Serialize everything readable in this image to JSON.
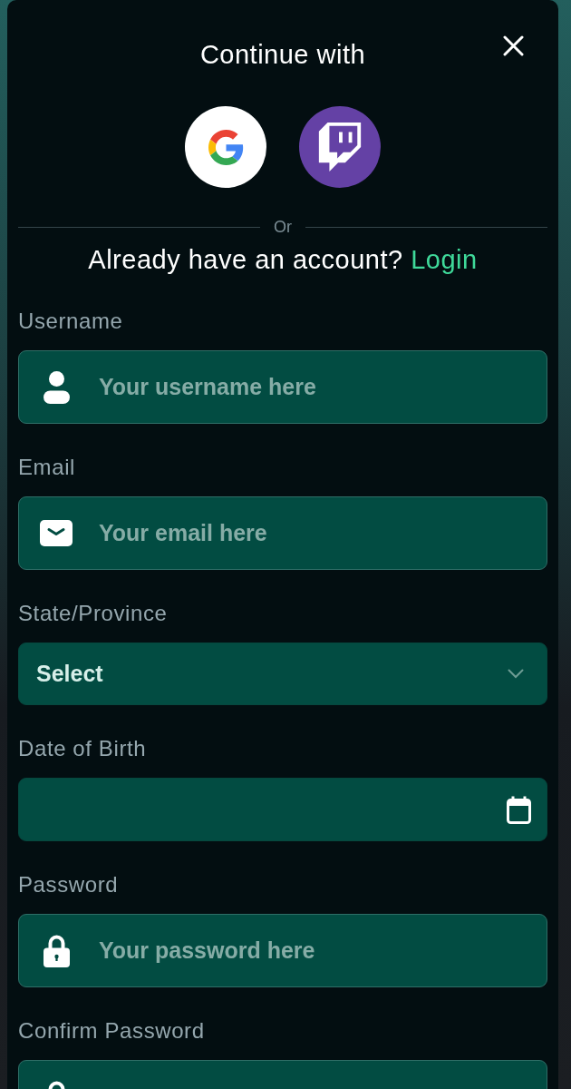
{
  "dialog": {
    "title": "Continue with",
    "social_buttons": [
      {
        "kind": "google"
      },
      {
        "kind": "twitch"
      }
    ],
    "divider_text": "Or",
    "login_prompt": {
      "text": "Already have an account?",
      "link": "Login"
    }
  },
  "form": {
    "fields": [
      {
        "label": "Username",
        "kind": "text",
        "placeholder": "Your username here"
      },
      {
        "label": "Email",
        "kind": "email",
        "placeholder": "Your email here"
      },
      {
        "label": "State/Province",
        "kind": "select",
        "value": "Select"
      },
      {
        "label": "Date of Birth",
        "kind": "date"
      },
      {
        "label": "Password",
        "kind": "password",
        "placeholder": "Your password here"
      },
      {
        "label": "Confirm Password",
        "kind": "password"
      }
    ]
  }
}
